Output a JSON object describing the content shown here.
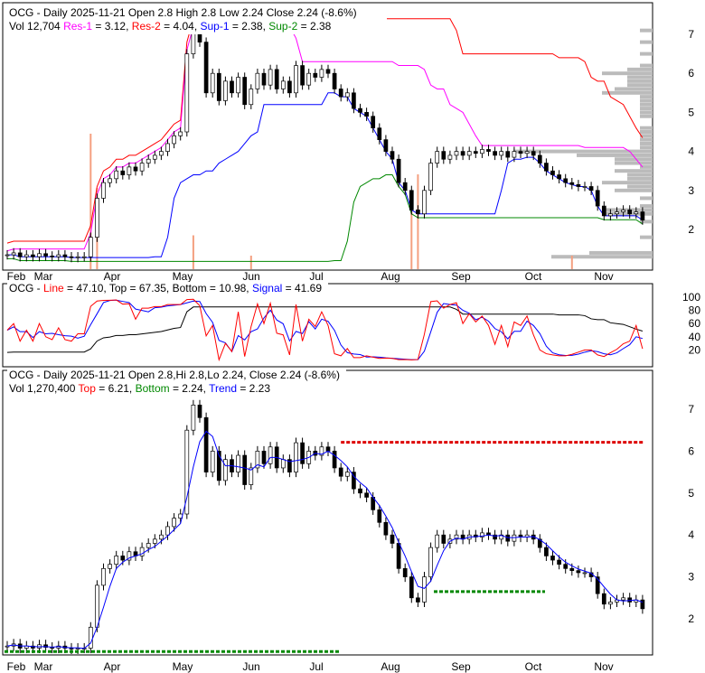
{
  "panel1": {
    "ticker": "OCG",
    "title": "OCG - Daily 2025-11-21 Open 2.8  High 2.8  Low 2.24  Close 2.24 (-8.6%)",
    "vol": "Vol 12,704",
    "res1_label": "Res-1",
    "res1": " = 3.12, ",
    "res2_label": "Res-2",
    "res2": " = 4.04, ",
    "sup1_label": "Sup-1",
    "sup1": " = 2.38, ",
    "sup2_label": "Sup-2",
    "sup2": " = 2.38",
    "yticks": [
      "2",
      "3",
      "4",
      "5",
      "6",
      "7"
    ]
  },
  "panel2": {
    "prefix": "OCG - ",
    "line_label": "Line",
    "line": " = 47.10, Top = 67.35, Bottom = 10.98, ",
    "signal_label": "Signal",
    "signal": " = 41.69",
    "yticks": [
      "20",
      "40",
      "60",
      "80",
      "100"
    ]
  },
  "panel3": {
    "title": "OCG - Daily 2025-11-21 Open 2.8,Hi 2.8,Lo 2.24, Close 2.24 (-8.6%)",
    "vol": "Vol 1,270,400 ",
    "top_label": "Top",
    "top": " = 6.21, ",
    "bottom_label": "Bottom",
    "bottom": " = 2.24, ",
    "trend_label": "Trend",
    "trend": " = 2.23",
    "yticks": [
      "2",
      "3",
      "4",
      "5",
      "6",
      "7"
    ]
  },
  "colors": {
    "up": "#008800",
    "down": "#dd0000",
    "ma": "#0000ff",
    "res1": "#ff00ff",
    "res2": "#ff0000",
    "sup1": "#0000ff",
    "sup2": "#008800"
  },
  "chart_data": {
    "type": "candlestick",
    "title": "OCG - Daily 2025-11-21",
    "xlabels": [
      "Feb",
      "Mar",
      "Apr",
      "May",
      "Jun",
      "Jul",
      "Aug",
      "Sep",
      "Oct",
      "Nov"
    ],
    "ylim": [
      1.2,
      7.5
    ],
    "close": [
      1.35,
      1.4,
      1.3,
      1.35,
      1.3,
      1.38,
      1.32,
      1.3,
      1.35,
      1.3,
      1.28,
      1.3,
      1.3,
      1.8,
      2.8,
      3.2,
      3.3,
      3.5,
      3.4,
      3.6,
      3.5,
      3.7,
      3.8,
      3.9,
      4.0,
      4.2,
      4.4,
      4.5,
      6.5,
      7.1,
      6.8,
      5.5,
      6.0,
      5.3,
      5.8,
      5.5,
      5.9,
      5.2,
      5.6,
      6.0,
      5.7,
      6.1,
      5.6,
      5.8,
      5.5,
      6.2,
      5.7,
      6.0,
      5.9,
      6.1,
      6.0,
      5.6,
      5.4,
      5.5,
      5.1,
      5.0,
      4.9,
      4.6,
      4.3,
      4.0,
      3.8,
      3.2,
      3.0,
      2.5,
      2.4,
      3.0,
      3.7,
      4.0,
      3.8,
      3.9,
      4.0,
      3.9,
      4.0,
      3.95,
      4.05,
      4.0,
      3.9,
      4.0,
      3.85,
      4.0,
      3.95,
      4.0,
      3.9,
      3.7,
      3.5,
      3.4,
      3.3,
      3.2,
      3.15,
      3.1,
      3.1,
      3.0,
      2.6,
      2.35,
      2.4,
      2.45,
      2.5,
      2.4,
      2.45,
      2.24
    ],
    "volume_spikes": [
      {
        "i": 13,
        "v": 100
      },
      {
        "i": 14,
        "v": 60
      },
      {
        "i": 29,
        "v": 25
      },
      {
        "i": 38,
        "v": 10
      },
      {
        "i": 63,
        "v": 45
      },
      {
        "i": 64,
        "v": 70
      },
      {
        "i": 88,
        "v": 10
      }
    ]
  }
}
